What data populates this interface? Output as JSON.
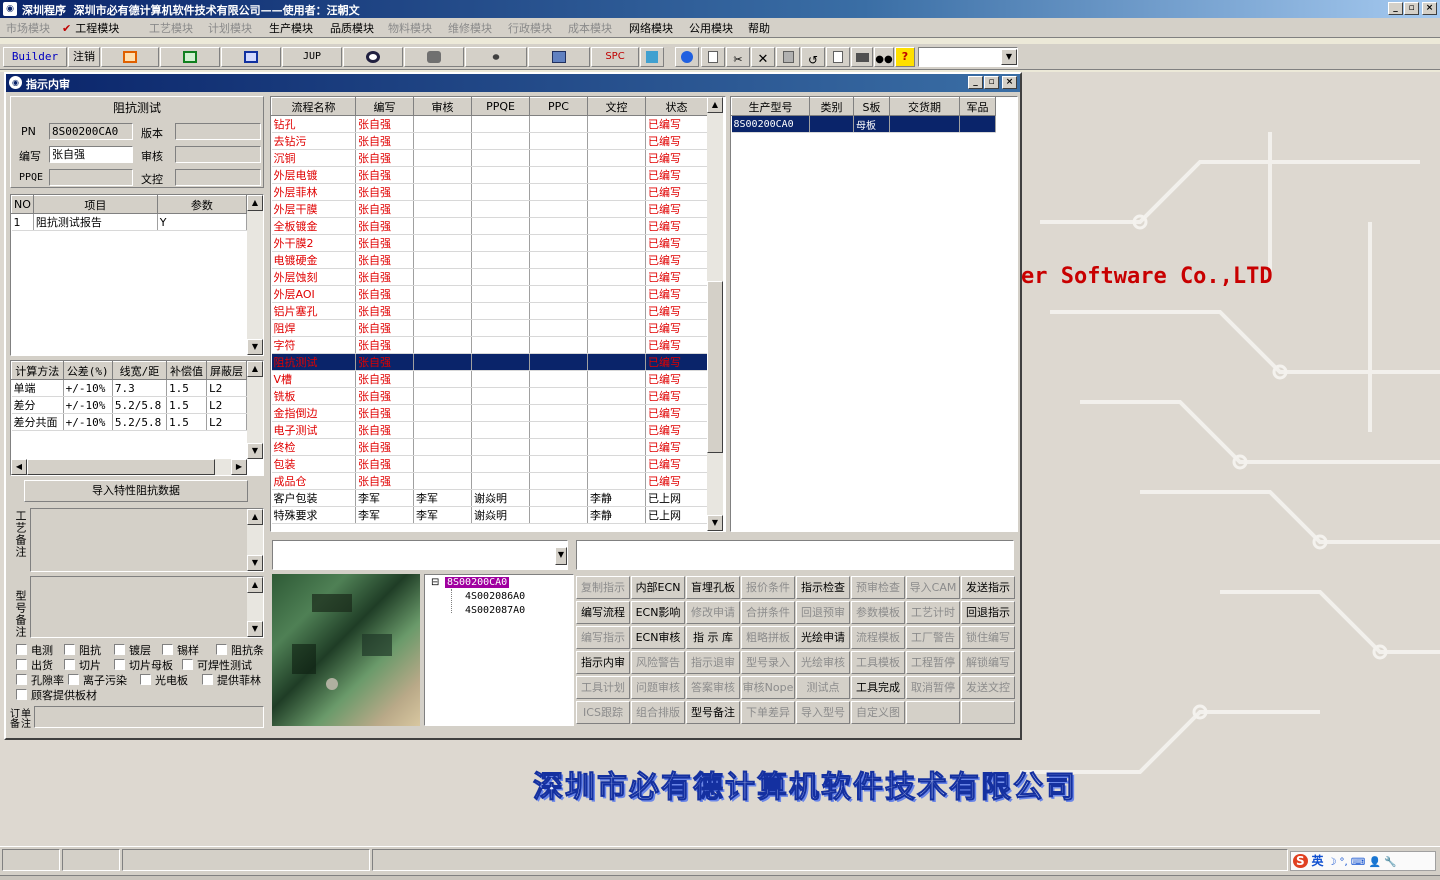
{
  "titlebar": {
    "title": "深圳程序  深圳市必有德计算机软件技术有限公司——使用者：汪朝文",
    "min": "_",
    "max": "▫",
    "close": "×"
  },
  "menu": {
    "items": [
      {
        "label": "市场模块",
        "enabled": false
      },
      {
        "label": "工程模块",
        "enabled": true,
        "checked": true
      },
      {
        "label": "工艺模块",
        "enabled": false
      },
      {
        "label": "计划模块",
        "enabled": false
      },
      {
        "label": "生产模块",
        "enabled": true
      },
      {
        "label": "品质模块",
        "enabled": true
      },
      {
        "label": "物料模块",
        "enabled": false
      },
      {
        "label": "维修模块",
        "enabled": false
      },
      {
        "label": "行政模块",
        "enabled": false
      },
      {
        "label": "成本模块",
        "enabled": false
      },
      {
        "label": "网络模块",
        "enabled": true
      },
      {
        "label": "公用模块",
        "enabled": true
      },
      {
        "label": "帮助",
        "enabled": true
      }
    ],
    "check": "✔"
  },
  "toolbar": {
    "builder": "Builder",
    "logout": "注销",
    "jup": "JUP",
    "spc": "SPC",
    "help": "?"
  },
  "brand": {
    "english": "er Software Co.,LTD",
    "chinese": "深圳市必有德计算机软件技术有限公司"
  },
  "window": {
    "title": "指示内审",
    "min": "_",
    "max": "▫",
    "close": "×"
  },
  "left": {
    "section_title": "阻抗测试",
    "pn_label": "PN",
    "pn_value": "8S00200CA0",
    "version_label": "版本",
    "version_value": "",
    "writer_label": "编写",
    "writer_value": "张自强",
    "review_label": "审核",
    "review_value": "",
    "ppqe_label": "PPQE",
    "ppqe_value": "",
    "doc_label": "文控",
    "doc_value": "",
    "items_headers": [
      "NO",
      "项目",
      "参数"
    ],
    "items_rows": [
      [
        "1",
        "阻抗测试报告",
        "Y"
      ]
    ],
    "calc_headers": [
      "计算方法",
      "公差(%)",
      "线宽/距",
      "补偿值",
      "屏蔽层"
    ],
    "calc_rows": [
      [
        "单端",
        "+/-10%",
        "7.3",
        "1.5",
        "L2"
      ],
      [
        "差分",
        "+/-10%",
        "5.2/5.8",
        "1.5",
        "L2"
      ],
      [
        "差分共面",
        "+/-10%",
        "5.2/5.8",
        "1.5",
        "L2"
      ]
    ],
    "import_button": "导入特性阻抗数据",
    "process_note_label": "工艺备注",
    "model_note_label": "型号备注",
    "order_note_label": "订单备注",
    "checkboxes": [
      [
        "电测",
        "阻抗",
        "镀层",
        "锡样",
        "阻抗条"
      ],
      [
        "出货",
        "切片",
        "切片母板",
        "可焊性测试"
      ],
      [
        "孔隙率",
        "离子污染",
        "光电板",
        "提供菲林"
      ],
      [
        "顾客提供板材"
      ]
    ]
  },
  "flow": {
    "headers": [
      "流程名称",
      "编写",
      "审核",
      "PPQE",
      "PPC",
      "文控",
      "状态"
    ],
    "rows": [
      [
        "钻孔",
        "张自强",
        "",
        "",
        "",
        "",
        "已编写"
      ],
      [
        "去钻污",
        "张自强",
        "",
        "",
        "",
        "",
        "已编写"
      ],
      [
        "沉铜",
        "张自强",
        "",
        "",
        "",
        "",
        "已编写"
      ],
      [
        "外层电镀",
        "张自强",
        "",
        "",
        "",
        "",
        "已编写"
      ],
      [
        "外层菲林",
        "张自强",
        "",
        "",
        "",
        "",
        "已编写"
      ],
      [
        "外层干膜",
        "张自强",
        "",
        "",
        "",
        "",
        "已编写"
      ],
      [
        "全板镀金",
        "张自强",
        "",
        "",
        "",
        "",
        "已编写"
      ],
      [
        "外干膜2",
        "张自强",
        "",
        "",
        "",
        "",
        "已编写"
      ],
      [
        "电镀硬金",
        "张自强",
        "",
        "",
        "",
        "",
        "已编写"
      ],
      [
        "外层蚀刻",
        "张自强",
        "",
        "",
        "",
        "",
        "已编写"
      ],
      [
        "外层AOI",
        "张自强",
        "",
        "",
        "",
        "",
        "已编写"
      ],
      [
        "铝片塞孔",
        "张自强",
        "",
        "",
        "",
        "",
        "已编写"
      ],
      [
        "阻焊",
        "张自强",
        "",
        "",
        "",
        "",
        "已编写"
      ],
      [
        "字符",
        "张自强",
        "",
        "",
        "",
        "",
        "已编写"
      ],
      [
        "阻抗测试",
        "张自强",
        "",
        "",
        "",
        "",
        "已编写"
      ],
      [
        "V槽",
        "张自强",
        "",
        "",
        "",
        "",
        "已编写"
      ],
      [
        "铣板",
        "张自强",
        "",
        "",
        "",
        "",
        "已编写"
      ],
      [
        "金指倒边",
        "张自强",
        "",
        "",
        "",
        "",
        "已编写"
      ],
      [
        "电子测试",
        "张自强",
        "",
        "",
        "",
        "",
        "已编写"
      ],
      [
        "终检",
        "张自强",
        "",
        "",
        "",
        "",
        "已编写"
      ],
      [
        "包装",
        "张自强",
        "",
        "",
        "",
        "",
        "已编写"
      ],
      [
        "成品仓",
        "张自强",
        "",
        "",
        "",
        "",
        "已编写"
      ],
      [
        "客户包装",
        "李军",
        "李军",
        "谢焱明",
        "",
        "李静",
        "已上网"
      ],
      [
        "特殊要求",
        "李军",
        "李军",
        "谢焱明",
        "",
        "李静",
        "已上网"
      ]
    ],
    "selected_index": 14
  },
  "models": {
    "headers": [
      "生产型号",
      "类别",
      "S板",
      "交货期",
      "军品"
    ],
    "rows": [
      [
        "8S00200CA0",
        "",
        "母板",
        "",
        ""
      ]
    ]
  },
  "tree": {
    "root": "8S00200CA0",
    "children": [
      "4S002086A0",
      "4S002087A0"
    ],
    "toggle": "⊟"
  },
  "actions": [
    [
      {
        "t": "复制指示",
        "e": false
      },
      {
        "t": "内部ECN",
        "e": true
      },
      {
        "t": "盲埋孔板",
        "e": true
      },
      {
        "t": "报价条件",
        "e": false
      },
      {
        "t": "指示检查",
        "e": true
      },
      {
        "t": "预审检查",
        "e": false
      },
      {
        "t": "导入CAM",
        "e": false
      },
      {
        "t": "发送指示",
        "e": true
      }
    ],
    [
      {
        "t": "编写流程",
        "e": true
      },
      {
        "t": "ECN影响",
        "e": true
      },
      {
        "t": "修改申请",
        "e": false
      },
      {
        "t": "合拼条件",
        "e": false
      },
      {
        "t": "回退预审",
        "e": false
      },
      {
        "t": "参数模板",
        "e": false
      },
      {
        "t": "工艺计时",
        "e": false
      },
      {
        "t": "回退指示",
        "e": true
      }
    ],
    [
      {
        "t": "编写指示",
        "e": false
      },
      {
        "t": "ECN审核",
        "e": true
      },
      {
        "t": "指 示 库",
        "e": true
      },
      {
        "t": "粗略拼板",
        "e": false
      },
      {
        "t": "光绘申请",
        "e": true
      },
      {
        "t": "流程模板",
        "e": false
      },
      {
        "t": "工厂警告",
        "e": false
      },
      {
        "t": "锁住编写",
        "e": false
      }
    ],
    [
      {
        "t": "指示内审",
        "e": true
      },
      {
        "t": "风险警告",
        "e": false
      },
      {
        "t": "指示退审",
        "e": false
      },
      {
        "t": "型号录入",
        "e": false
      },
      {
        "t": "光绘审核",
        "e": false
      },
      {
        "t": "工具模板",
        "e": false
      },
      {
        "t": "工程暂停",
        "e": false
      },
      {
        "t": "解锁编写",
        "e": false
      }
    ],
    [
      {
        "t": "工具计划",
        "e": false
      },
      {
        "t": "问题审核",
        "e": false
      },
      {
        "t": "答案审核",
        "e": false
      },
      {
        "t": "审核Nope",
        "e": false
      },
      {
        "t": "测试点",
        "e": false
      },
      {
        "t": "工具完成",
        "e": true
      },
      {
        "t": "取消暂停",
        "e": false
      },
      {
        "t": "发送文控",
        "e": false
      }
    ],
    [
      {
        "t": "ICS跟踪",
        "e": false
      },
      {
        "t": "组合排版",
        "e": false
      },
      {
        "t": "型号备注",
        "e": true
      },
      {
        "t": "下单差异",
        "e": false
      },
      {
        "t": "导入型号",
        "e": false
      },
      {
        "t": "自定义图",
        "e": false
      },
      {
        "t": "",
        "e": false
      },
      {
        "t": "",
        "e": false
      }
    ]
  ],
  "tray": {
    "ime": "英",
    "symbols": "☽ °, ⌨ 👤 🔧"
  },
  "colors": {
    "selection": "#0a246a",
    "status_red": "#e00000",
    "brand_red": "#c80000",
    "brand_blue": "#2a4fd8"
  }
}
